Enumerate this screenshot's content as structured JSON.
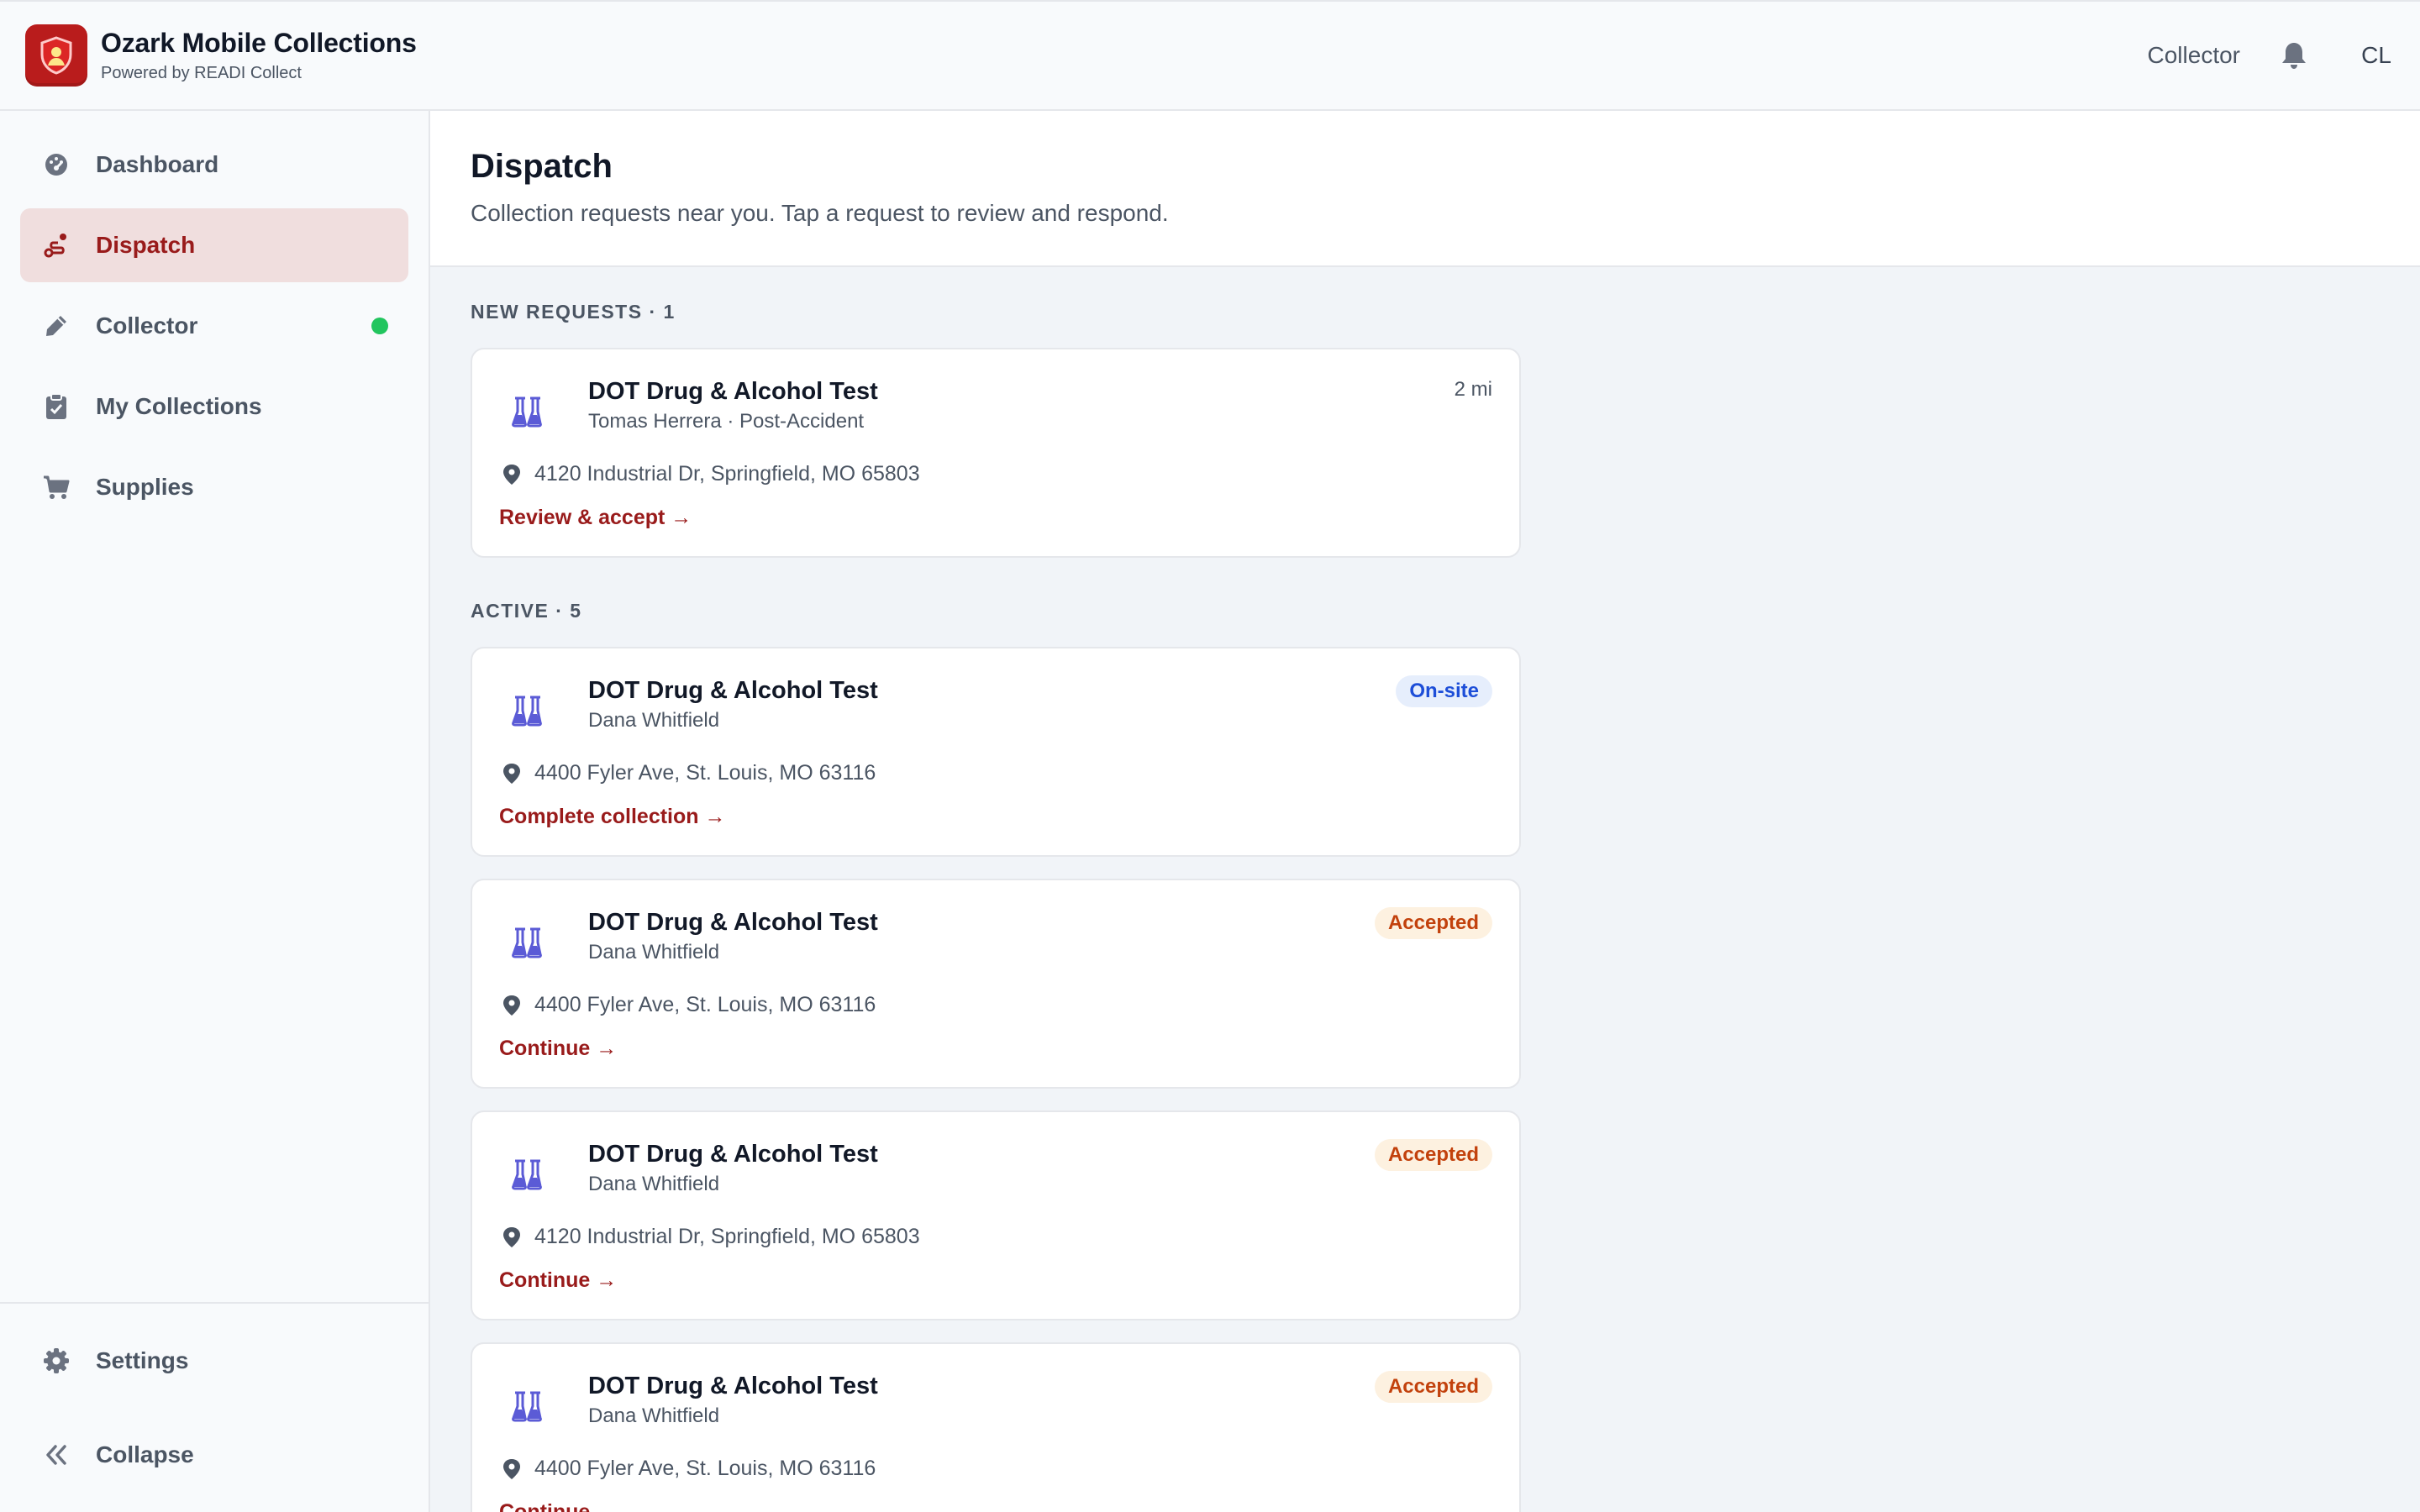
{
  "header": {
    "app_title": "Ozark Mobile Collections",
    "app_subtitle": "Powered by READI Collect",
    "role_label": "Collector",
    "avatar_initials": "CL"
  },
  "sidebar": {
    "items": [
      {
        "label": "Dashboard",
        "icon": "gauge-icon",
        "active": false
      },
      {
        "label": "Dispatch",
        "icon": "route-icon",
        "active": true
      },
      {
        "label": "Collector",
        "icon": "pen-icon",
        "active": false,
        "status": "online"
      },
      {
        "label": "My Collections",
        "icon": "clipboard-icon",
        "active": false
      },
      {
        "label": "Supplies",
        "icon": "cart-icon",
        "active": false
      }
    ],
    "footer": [
      {
        "label": "Settings",
        "icon": "gear-icon"
      },
      {
        "label": "Collapse",
        "icon": "double-chevron-left-icon"
      }
    ]
  },
  "page": {
    "title": "Dispatch",
    "subtitle": "Collection requests near you. Tap a request to review and respond."
  },
  "sections": {
    "new_label": "NEW REQUESTS · 1",
    "active_label": "ACTIVE · 5"
  },
  "new_requests": [
    {
      "title": "DOT Drug & Alcohol Test",
      "subtitle": "Tomas Herrera · Post-Accident",
      "address": "4120 Industrial Dr, Springfield, MO 65803",
      "distance": "2 mi",
      "action": "Review & accept →"
    }
  ],
  "active": [
    {
      "title": "DOT Drug & Alcohol Test",
      "subtitle": "Dana Whitfield",
      "address": "4400 Fyler Ave, St. Louis, MO 63116",
      "status": "On-site",
      "action": "Complete collection →"
    },
    {
      "title": "DOT Drug & Alcohol Test",
      "subtitle": "Dana Whitfield",
      "address": "4400 Fyler Ave, St. Louis, MO 63116",
      "status": "Accepted",
      "action": "Continue →"
    },
    {
      "title": "DOT Drug & Alcohol Test",
      "subtitle": "Dana Whitfield",
      "address": "4120 Industrial Dr, Springfield, MO 65803",
      "status": "Accepted",
      "action": "Continue →"
    },
    {
      "title": "DOT Drug & Alcohol Test",
      "subtitle": "Dana Whitfield",
      "address": "4400 Fyler Ave, St. Louis, MO 63116",
      "status": "Accepted",
      "action": "Continue →"
    }
  ],
  "colors": {
    "brand": "#b91c1c",
    "active_nav_bg": "#f0dede",
    "action_link": "#991b1b",
    "online_dot": "#22c55e",
    "onsite_badge": "#1d4ed8",
    "accepted_badge": "#c2410c",
    "flask_icon": "#5b5bd6"
  }
}
